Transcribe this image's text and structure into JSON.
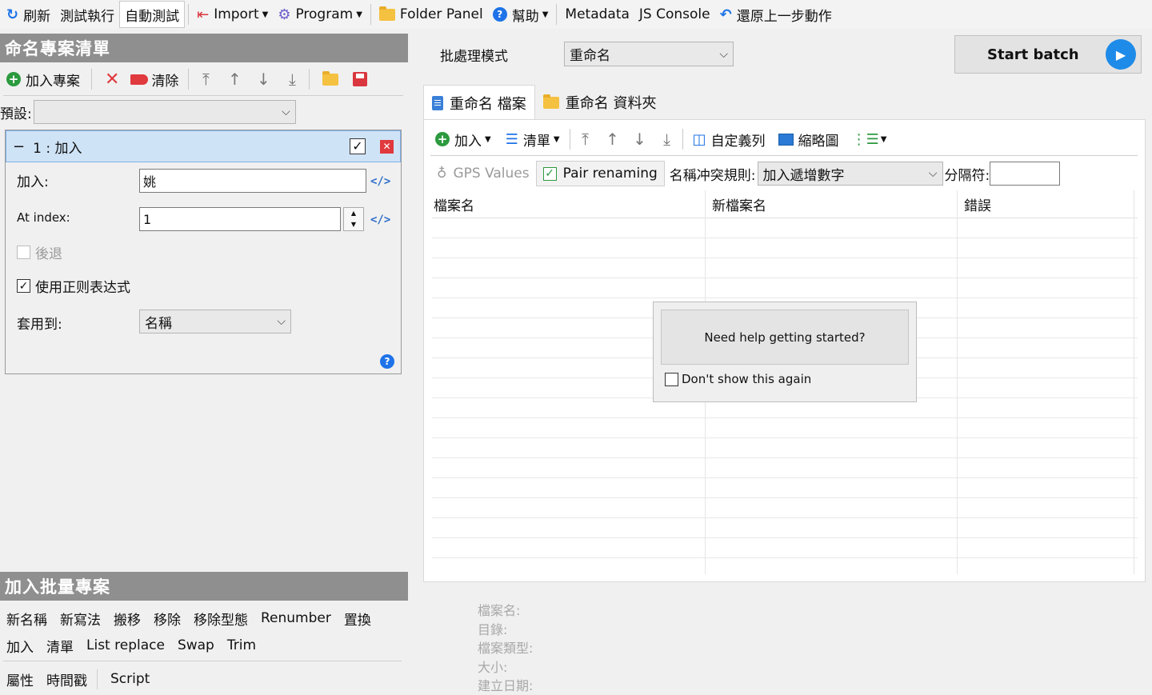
{
  "toolbar": {
    "refresh": "刷新",
    "test_run": "測試執行",
    "auto_test": "自動測試",
    "import": "Import",
    "program": "Program",
    "folder_panel": "Folder Panel",
    "help": "幫助",
    "metadata": "Metadata",
    "js_console": "JS Console",
    "undo": "還原上一步動作"
  },
  "left_pane": {
    "header": "命名專案清單",
    "add_project": "加入專案",
    "clear": "清除",
    "preset_label": "預設:",
    "preset_value": "",
    "rule": {
      "title": "1 : 加入",
      "add_label": "加入:",
      "add_value": "姚",
      "at_index_label": "At index:",
      "at_index_value": "1",
      "backward_label": "後退",
      "regex_label": "使用正则表达式",
      "apply_to_label": "套用到:",
      "apply_to_value": "名稱"
    },
    "batch_header": "加入批量專案",
    "batch_row1": [
      "新名稱",
      "新寫法",
      "搬移",
      "移除",
      "移除型態",
      "Renumber",
      "置換"
    ],
    "batch_row2": [
      "加入",
      "清單",
      "List replace",
      "Swap",
      "Trim"
    ],
    "batch_row3": [
      "屬性",
      "時間戳",
      "Script"
    ]
  },
  "right_pane": {
    "batch_mode_label": "批處理模式",
    "batch_mode_value": "重命名",
    "start_batch": "Start batch",
    "tabs": [
      "重命名 檔案",
      "重命名 資料夾"
    ],
    "list_toolbar": {
      "add": "加入",
      "list": "清單",
      "custom_columns": "自定義列",
      "thumbnails": "縮略圖"
    },
    "gps_values": "GPS Values",
    "pair_renaming": "Pair renaming",
    "conflict_label": "名稱冲突規則:",
    "conflict_value": "加入遞增數字",
    "separator_label": "分隔符:",
    "separator_value": "",
    "columns": [
      "檔案名",
      "新檔案名",
      "錯誤"
    ],
    "help_popup": {
      "button": "Need help getting started?",
      "dont_show": "Don't show this again"
    },
    "details": [
      "檔案名:",
      "目錄:",
      "檔案類型:",
      "大小:",
      "建立日期:"
    ]
  },
  "colors": {
    "header_gray": "#8f8f8f",
    "rule_header": "#cfe3f7",
    "accent_blue": "#1e73e8",
    "delete_red": "#e0393e",
    "green": "#2c9a3f"
  }
}
